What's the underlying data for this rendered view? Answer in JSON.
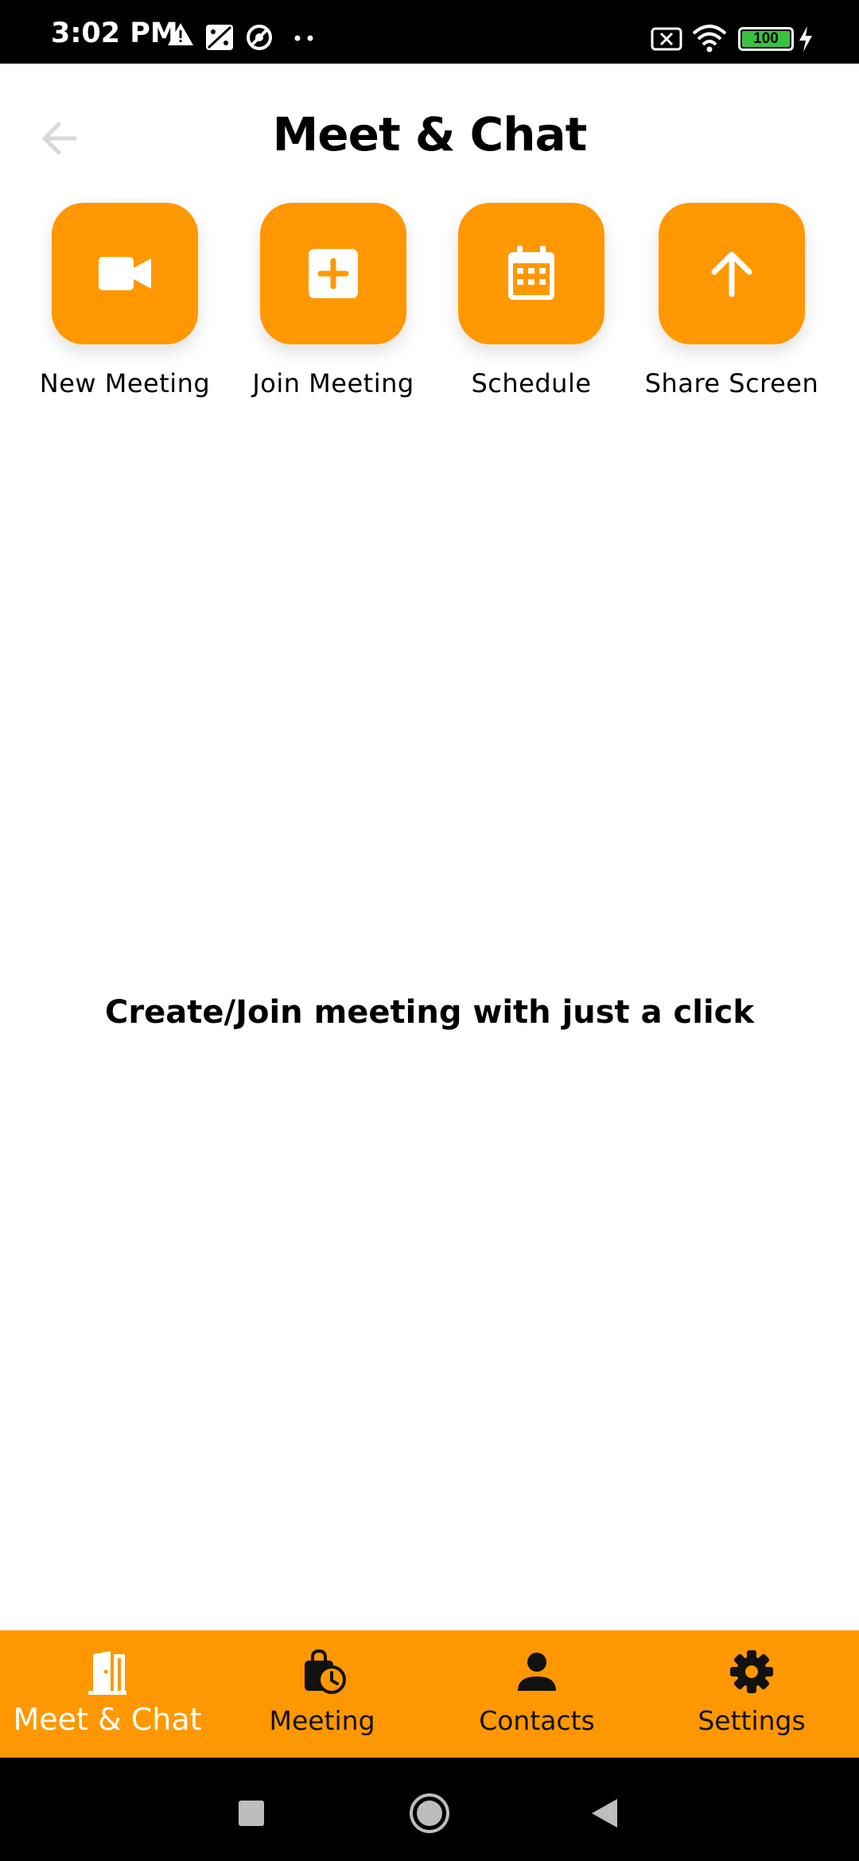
{
  "status_bar": {
    "time": "3:02 PM",
    "battery": "100",
    "icons": [
      "warning-icon",
      "dice-icon",
      "do-not-disturb-icon",
      "more-dots-icon",
      "no-sim-icon",
      "wifi-icon",
      "battery-icon",
      "charging-icon"
    ]
  },
  "header": {
    "title": "Meet & Chat",
    "back_icon": "arrow-back-icon"
  },
  "actions": [
    {
      "label": "New Meeting",
      "icon": "video-camera-icon"
    },
    {
      "label": "Join Meeting",
      "icon": "add-box-icon"
    },
    {
      "label": "Schedule",
      "icon": "calendar-icon"
    },
    {
      "label": "Share Screen",
      "icon": "arrow-upward-icon"
    }
  ],
  "main": {
    "message": "Create/Join meeting with just a click"
  },
  "bottom_nav": {
    "items": [
      {
        "label": "Meet & Chat",
        "icon": "door-icon",
        "active": true
      },
      {
        "label": "Meeting",
        "icon": "bag-clock-icon",
        "active": false
      },
      {
        "label": "Contacts",
        "icon": "person-icon",
        "active": false
      },
      {
        "label": "Settings",
        "icon": "gear-icon",
        "active": false
      }
    ]
  },
  "colors": {
    "accent": "#FF9800",
    "status_bar": "#000000",
    "background": "#FFFFFF"
  }
}
